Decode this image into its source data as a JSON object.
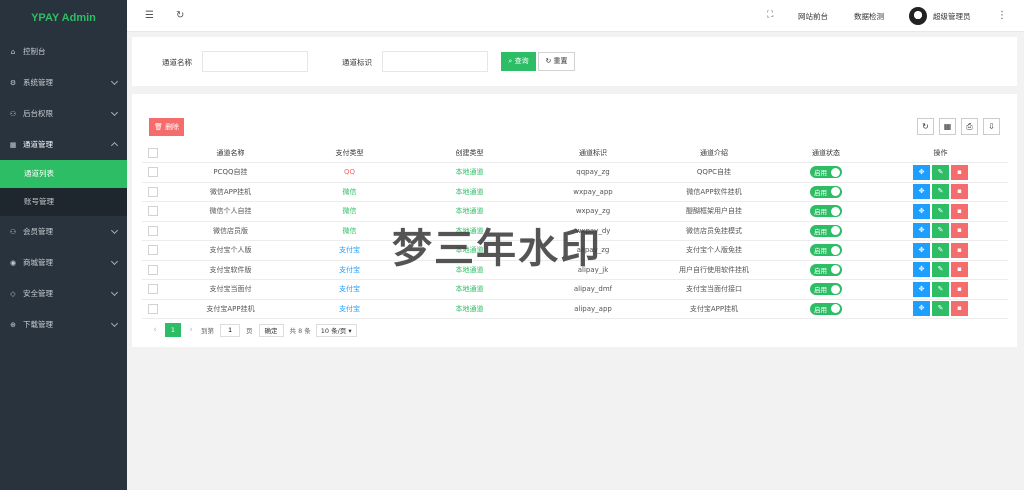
{
  "app": {
    "title": "YPAY Admin"
  },
  "sidebar": {
    "items": [
      {
        "label": "控制台",
        "icon": "home-icon"
      },
      {
        "label": "系统管理",
        "icon": "gear-icon"
      },
      {
        "label": "后台权限",
        "icon": "user-icon"
      },
      {
        "label": "通道管理",
        "icon": "channel-icon"
      },
      {
        "label": "会员管理",
        "icon": "user-icon"
      },
      {
        "label": "商城管理",
        "icon": "shop-icon"
      },
      {
        "label": "安全管理",
        "icon": "diamond-icon"
      },
      {
        "label": "下载管理",
        "icon": "download-icon"
      }
    ],
    "submenu": [
      {
        "label": "通道列表"
      },
      {
        "label": "账号管理"
      }
    ]
  },
  "header": {
    "links": {
      "site_front": "网站前台",
      "data_check": "数据检测"
    },
    "user": "超级管理员"
  },
  "search": {
    "name_label": "通道名称",
    "name_value": "",
    "id_label": "通道标识",
    "id_value": "",
    "query_label": "查询",
    "reset_label": "重置"
  },
  "toolbar": {
    "delete_label": "删除"
  },
  "table": {
    "headers": [
      "通道名称",
      "支付类型",
      "创建类型",
      "通道标识",
      "通道介绍",
      "通道状态",
      "操作"
    ],
    "rows": [
      {
        "name": "PCQQ自挂",
        "pay_type": "QQ",
        "create_type": "本地通道",
        "code": "qqpay_zg",
        "intro": "QQPC自挂",
        "status": "启用"
      },
      {
        "name": "微信APP挂机",
        "pay_type": "微信",
        "create_type": "本地通道",
        "code": "wxpay_app",
        "intro": "微信APP软件挂机",
        "status": "启用"
      },
      {
        "name": "微信个人自挂",
        "pay_type": "微信",
        "create_type": "本地通道",
        "code": "wxpay_zg",
        "intro": "醍醐框架用户自挂",
        "status": "启用"
      },
      {
        "name": "微信店员版",
        "pay_type": "微信",
        "create_type": "本地通道",
        "code": "wxpay_dy",
        "intro": "微信店员免挂模式",
        "status": "启用"
      },
      {
        "name": "支付宝个人版",
        "pay_type": "支付宝",
        "create_type": "本地通道",
        "code": "alipay_zg",
        "intro": "支付宝个人版免挂",
        "status": "启用"
      },
      {
        "name": "支付宝软件版",
        "pay_type": "支付宝",
        "create_type": "本地通道",
        "code": "alipay_jk",
        "intro": "用户自行使用软件挂机",
        "status": "启用"
      },
      {
        "name": "支付宝当面付",
        "pay_type": "支付宝",
        "create_type": "本地通道",
        "code": "alipay_dmf",
        "intro": "支付宝当面付接口",
        "status": "启用"
      },
      {
        "name": "支付宝APP挂机",
        "pay_type": "支付宝",
        "create_type": "本地通道",
        "code": "alipay_app",
        "intro": "支付宝APP挂机",
        "status": "启用"
      }
    ]
  },
  "pagination": {
    "current": "1",
    "goto_label": "到第",
    "page_input": "1",
    "page_unit": "页",
    "confirm_label": "确定",
    "total": "共 8 条",
    "page_size": "10 条/页"
  },
  "watermark": "梦三年水印",
  "colors": {
    "accent": "#2dbd64",
    "danger": "#f56c6c",
    "info": "#1e9fff",
    "sidebar": "#28333e"
  }
}
